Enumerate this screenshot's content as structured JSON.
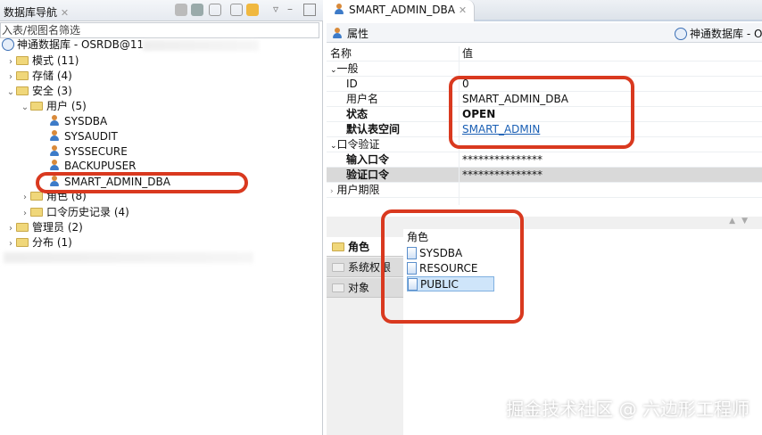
{
  "nav": {
    "title": "数据库导航",
    "close": "✕",
    "filter_placeholder": "入表/视图名筛选",
    "root": "神通数据库 - OSRDB@11",
    "items": [
      {
        "label": "模式 (11)",
        "chev": "›"
      },
      {
        "label": "存储 (4)",
        "chev": "›"
      },
      {
        "label": "安全 (3)",
        "chev": "⌄"
      },
      {
        "label": "用户 (5)",
        "chev": "⌄"
      },
      {
        "label": "SYSDBA"
      },
      {
        "label": "SYSAUDIT"
      },
      {
        "label": "SYSSECURE"
      },
      {
        "label": "BACKUPUSER"
      },
      {
        "label": "SMART_ADMIN_DBA"
      },
      {
        "label": "角色 (8)",
        "chev": "›"
      },
      {
        "label": "口令历史记录 (4)",
        "chev": "›"
      },
      {
        "label": "管理员 (2)",
        "chev": "›"
      },
      {
        "label": "分布 (1)",
        "chev": "›"
      }
    ]
  },
  "editor": {
    "tab": "SMART_ADMIN_DBA",
    "close": "✕",
    "subtab": "属性",
    "connection": "神通数据库 - O",
    "col_name": "名称",
    "col_value": "值",
    "groups": {
      "general": "一般",
      "password": "口令验证",
      "expiry": "用户期限"
    },
    "props": {
      "id_l": "ID",
      "id_v": "0",
      "user_l": "用户名",
      "user_v": "SMART_ADMIN_DBA",
      "status_l": "状态",
      "status_v": "OPEN",
      "ts_l": "默认表空间",
      "ts_v": "SMART_ADMIN",
      "pw_l": "输入口令",
      "pw_v": "***************",
      "pw2_l": "验证口令",
      "pw2_v": "***************"
    },
    "side_tabs": [
      "角色",
      "系统权限",
      "对象"
    ],
    "roles_header": "角色",
    "roles": [
      "SYSDBA",
      "RESOURCE",
      "PUBLIC"
    ]
  },
  "watermark": "掘金技术社区 @ 六边形工程师",
  "colors": {
    "annotation": "#d9391f",
    "link": "#1a5fb4"
  }
}
